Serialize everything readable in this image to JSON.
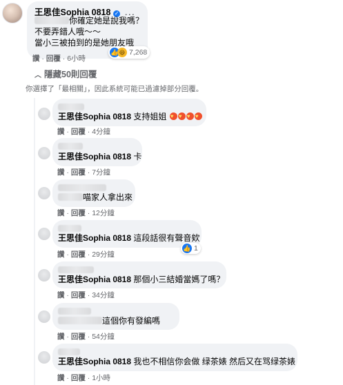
{
  "top_comment": {
    "author": "王思佳Sophia 0818",
    "lines": [
      "你確定她是說我嗎？",
      "不要弄錯人哦～～",
      "當小三被拍到的是她朋友哦"
    ],
    "actions": {
      "like": "讚",
      "reply": "回覆",
      "time": "6小時"
    },
    "reaction_count": "7,268"
  },
  "hide_replies": "隱藏50則回覆",
  "notice": "你選擇了「最相關」，因此系統可能已過濾掉部分回覆。",
  "replies": [
    {
      "author": "王思佳Sophia 0818",
      "text": "支持姐姐",
      "like": "讚",
      "reply": "回覆",
      "time": "4分鐘"
    },
    {
      "author": "王思佳Sophia 0818",
      "text": "卡",
      "like": "讚",
      "reply": "回覆",
      "time": "7分鐘"
    },
    {
      "author": "",
      "text": "喵家人拿出來",
      "like": "讚",
      "reply": "回覆",
      "time": "12分鐘"
    },
    {
      "author": "王思佳Sophia 0818",
      "text": "這段話很有聲音欸",
      "like": "讚",
      "reply": "回覆",
      "time": "29分鐘",
      "reactions": "1"
    },
    {
      "author": "王思佳Sophia 0818",
      "text": "那個小三結婚當媽了嗎？",
      "like": "讚",
      "reply": "回覆",
      "time": "34分鐘"
    },
    {
      "author": "",
      "text": "這個你有發編嗎",
      "like": "讚",
      "reply": "回覆",
      "time": "54分鐘"
    },
    {
      "author": "王思佳Sophia 0818",
      "text": "我也不相信你会做 绿茶婊 然后又在骂绿茶婊",
      "like": "讚",
      "reply": "回覆",
      "time": "1小時"
    }
  ],
  "colors": {
    "bubble": "#f0f2f5",
    "meta": "#65676b",
    "like_blue": "#1877f2"
  }
}
